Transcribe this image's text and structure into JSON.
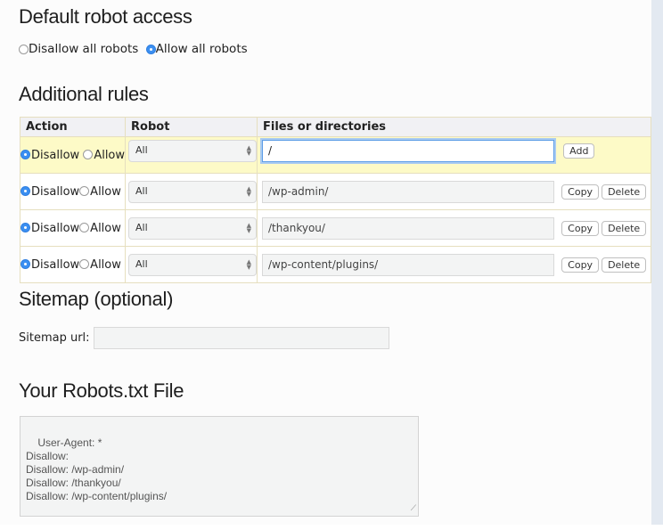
{
  "default_access": {
    "heading": "Default robot access",
    "options": [
      {
        "label": "Disallow all robots",
        "selected": false
      },
      {
        "label": "Allow all robots",
        "selected": true
      }
    ]
  },
  "rules": {
    "heading": "Additional rules",
    "columns": [
      "Action",
      "Robot",
      "Files or directories"
    ],
    "new_rule": {
      "disallow_label": "Disallow",
      "allow_label": "Allow",
      "action": "Disallow",
      "robot": "All",
      "path": "/",
      "add_label": "Add"
    },
    "rows": [
      {
        "disallow_label": "Disallow",
        "allow_label": "Allow",
        "action": "Disallow",
        "robot": "All",
        "path": "/wp-admin/",
        "copy_label": "Copy",
        "delete_label": "Delete"
      },
      {
        "disallow_label": "Disallow",
        "allow_label": "Allow",
        "action": "Disallow",
        "robot": "All",
        "path": "/thankyou/",
        "copy_label": "Copy",
        "delete_label": "Delete"
      },
      {
        "disallow_label": "Disallow",
        "allow_label": "Allow",
        "action": "Disallow",
        "robot": "All",
        "path": "/wp-content/plugins/",
        "copy_label": "Copy",
        "delete_label": "Delete"
      }
    ]
  },
  "sitemap": {
    "heading": "Sitemap (optional)",
    "label": "Sitemap url:",
    "value": ""
  },
  "output": {
    "heading": "Your Robots.txt File",
    "text": "User-Agent: *\nDisallow:\nDisallow: /wp-admin/\nDisallow: /thankyou/\nDisallow: /wp-content/plugins/"
  },
  "colors": {
    "accent": "#3b8ff1",
    "new_row_bg": "#fdfac7",
    "table_border": "#e6dfbf",
    "side_panel": "#e3e9f1"
  }
}
